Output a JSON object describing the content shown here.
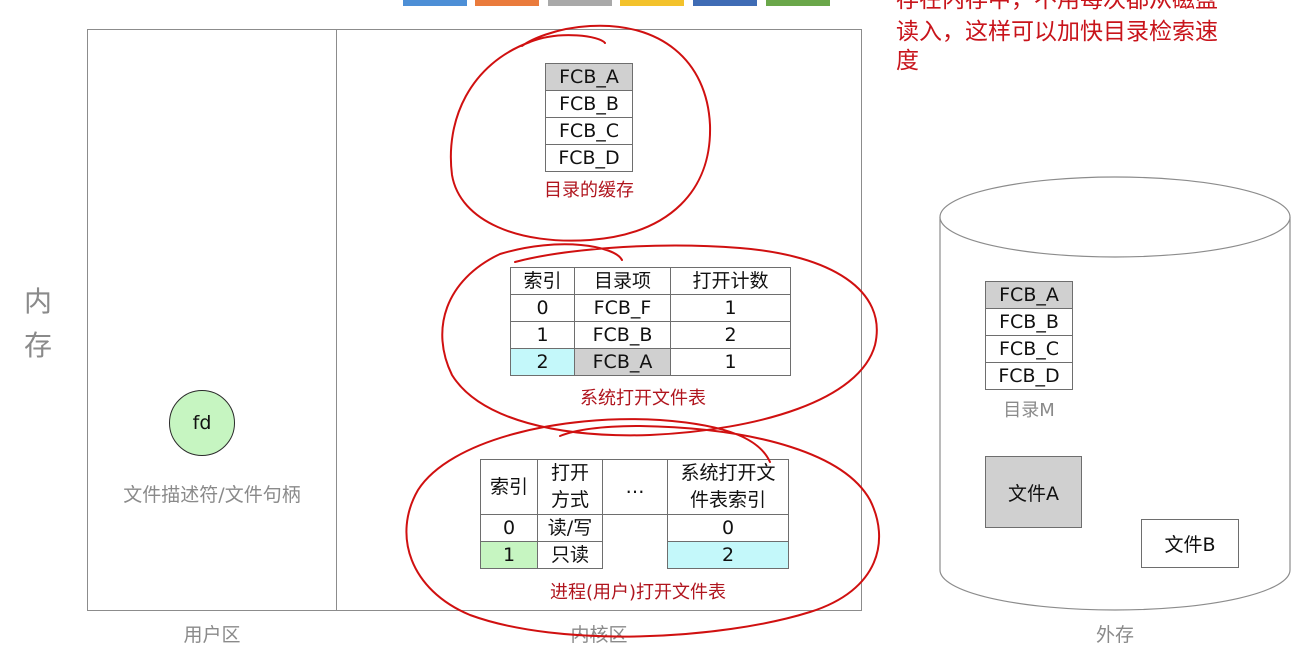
{
  "colors": {
    "accent_red": "#c8141b",
    "caption_red": "#b0151e",
    "label_gray": "#8a8a8a",
    "highlight_gray": "#d0d0d0",
    "highlight_cyan": "#c4f8fa",
    "highlight_green": "#c6f5c1",
    "fd_fill": "#c6f5c1",
    "top_strip": [
      "#4d8fd6",
      "#ea7b3c",
      "#a9a9a9",
      "#f3c22b",
      "#3f6cb5",
      "#6aa74a"
    ]
  },
  "annotation_note": {
    "lines": [
      "存在内存中，不用每次都从磁盘",
      "读入，这样可以加快目录检索速",
      "度"
    ]
  },
  "memory_label": [
    "内",
    "存"
  ],
  "user_area": {
    "fd_label": "fd",
    "fd_caption": "文件描述符/文件句柄",
    "area_label": "用户区"
  },
  "kernel_area": {
    "area_label": "内核区",
    "dir_cache": {
      "items": [
        "FCB_A",
        "FCB_B",
        "FCB_C",
        "FCB_D"
      ],
      "caption": "目录的缓存"
    },
    "system_open_table": {
      "headers": [
        "索引",
        "目录项",
        "打开计数"
      ],
      "rows": [
        [
          "0",
          "FCB_F",
          "1"
        ],
        [
          "1",
          "FCB_B",
          "2"
        ],
        [
          "2",
          "FCB_A",
          "1"
        ]
      ],
      "caption": "系统打开文件表"
    },
    "process_open_table": {
      "headers": [
        "索引",
        "打开\n方式",
        "…",
        "系统打开文\n件表索引"
      ],
      "rows": [
        [
          "0",
          "读/写",
          "",
          "0"
        ],
        [
          "1",
          "只读",
          "",
          "2"
        ]
      ],
      "caption": "进程(用户)打开文件表"
    }
  },
  "external_storage": {
    "area_label": "外存",
    "directory": {
      "items": [
        "FCB_A",
        "FCB_B",
        "FCB_C",
        "FCB_D"
      ],
      "caption": "目录M"
    },
    "file_a": "文件A",
    "file_b": "文件B"
  }
}
